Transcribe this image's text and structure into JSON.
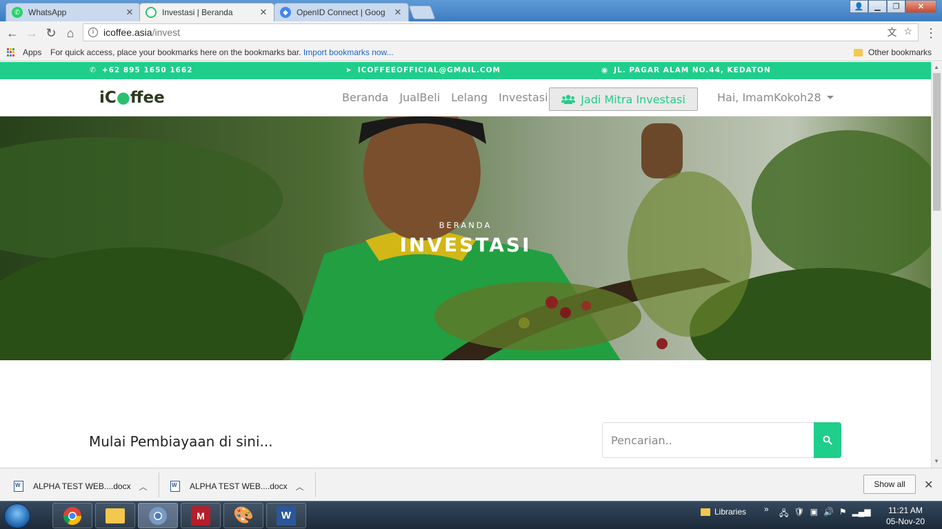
{
  "browser": {
    "tabs": [
      {
        "label": "WhatsApp",
        "favicon_color": "#25d366"
      },
      {
        "label": "Investasi | Beranda",
        "favicon_color": "#2c3a1e"
      },
      {
        "label": "OpenID Connect | Goog",
        "favicon_color": "#4285f4"
      }
    ],
    "url_host": "icoffee.asia",
    "url_path": "/invest",
    "bookmarks": {
      "apps_label": "Apps",
      "hint_text": "For quick access, place your bookmarks here on the bookmarks bar. ",
      "import_link": "Import bookmarks now...",
      "other_label": "Other bookmarks"
    }
  },
  "site": {
    "topbar": {
      "phone": "+62 895 1650 1662",
      "email": "ICOFFEEOFFICIAL@GMAIL.COM",
      "address": "JL. PAGAR ALAM NO.44, KEDATON"
    },
    "logo": {
      "part1": "iC",
      "part2": "ffee"
    },
    "menu": [
      "Beranda",
      "JualBeli",
      "Lelang",
      "Investasi"
    ],
    "cta_label": "Jadi Mitra Investasi",
    "user_label": "Hai, ImamKokoh28",
    "hero": {
      "kicker": "BERANDA",
      "title": "INVESTASI"
    },
    "section_title": "Mulai Pembiayaan di sini...",
    "search_placeholder": "Pencarian.."
  },
  "downloads": {
    "items": [
      "ALPHA TEST WEB....docx",
      "ALPHA TEST WEB....docx"
    ],
    "show_all": "Show all"
  },
  "taskbar": {
    "libraries_label": "Libraries",
    "time": "11:21 AM",
    "date": "05-Nov-20"
  },
  "colors": {
    "accent": "#1fce8a",
    "brand_dark": "#2c3a1e"
  }
}
